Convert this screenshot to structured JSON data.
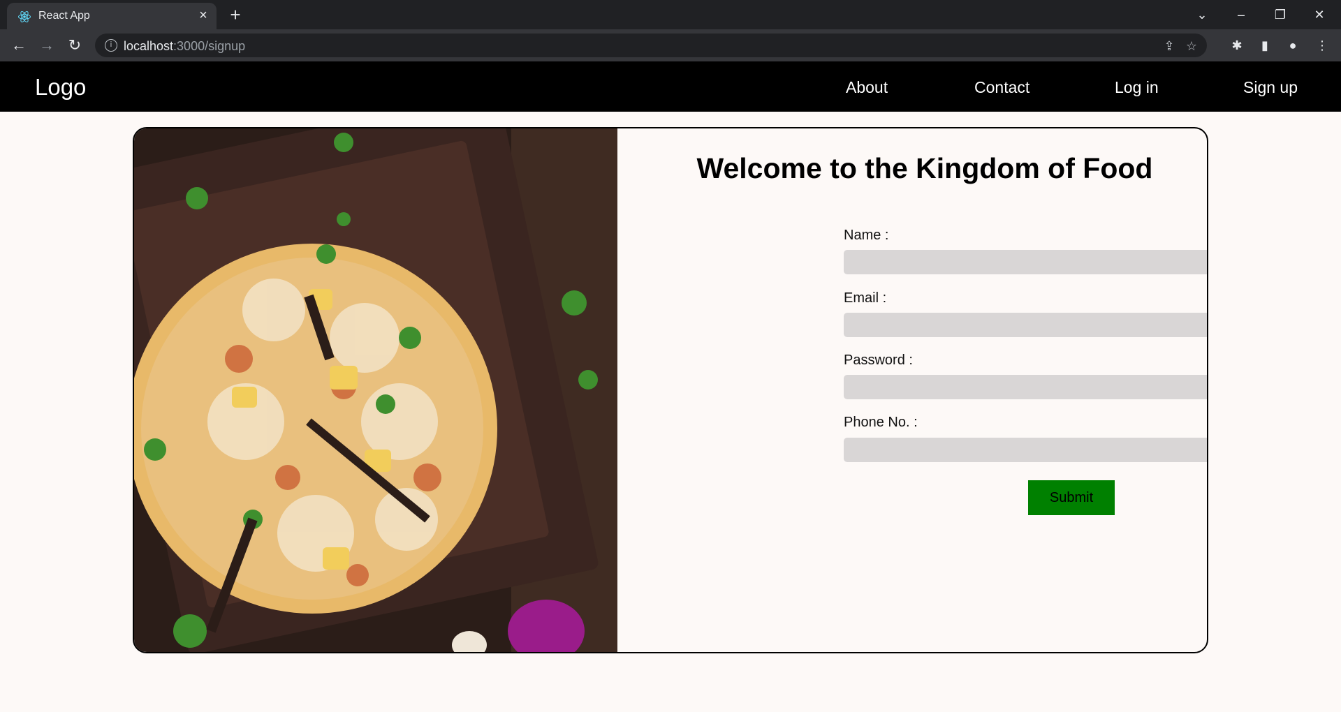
{
  "browser": {
    "tab_title": "React App",
    "url_host": "localhost",
    "url_path": ":3000/signup"
  },
  "navbar": {
    "logo": "Logo",
    "links": [
      "About",
      "Contact",
      "Log in",
      "Sign up"
    ]
  },
  "form": {
    "heading": "Welcome to the Kingdom of Food",
    "fields": [
      {
        "label": "Name :",
        "value": ""
      },
      {
        "label": "Email :",
        "value": ""
      },
      {
        "label": "Password :",
        "value": ""
      },
      {
        "label": "Phone No. :",
        "value": ""
      }
    ],
    "submit_label": "Submit"
  },
  "colors": {
    "navbar_bg": "#000000",
    "submit_bg": "#008000",
    "input_bg": "#d9d6d6",
    "page_bg": "#fdf9f7"
  },
  "icons": [
    "react-icon",
    "close-icon",
    "plus-icon",
    "back-arrow-icon",
    "forward-arrow-icon",
    "reload-icon",
    "info-icon",
    "share-icon",
    "star-icon",
    "extensions-icon",
    "side-panel-icon",
    "profile-icon",
    "menu-icon"
  ]
}
